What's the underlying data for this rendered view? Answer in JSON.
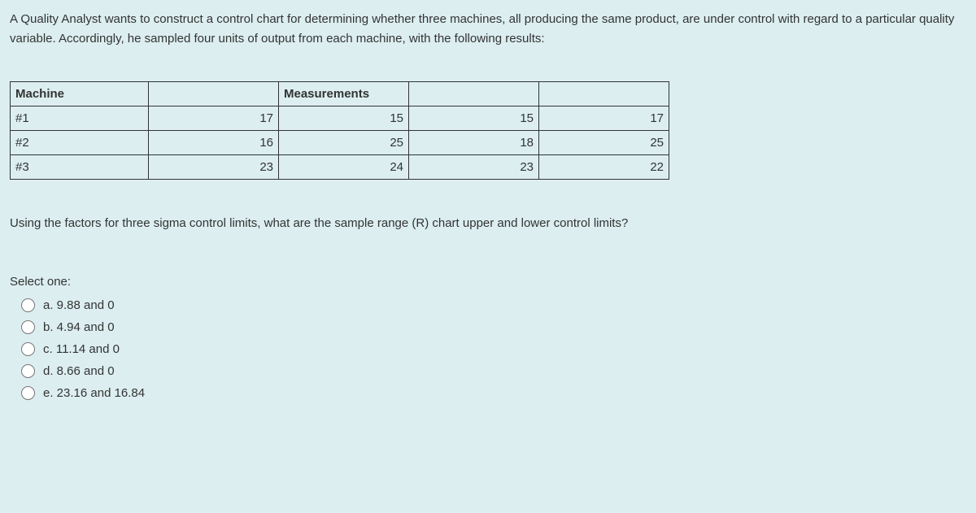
{
  "question": {
    "intro": "A Quality Analyst wants to construct a control chart for determining whether three machines, all producing the same product, are under control with regard to a particular quality variable. Accordingly, he sampled four units of output from each machine, with the following results:",
    "followup": "Using the factors for three sigma control limits, what are the sample range (R) chart upper and lower control limits?"
  },
  "table": {
    "header_machine": "Machine",
    "header_measurements": "Measurements",
    "rows": [
      {
        "machine": "#1",
        "m1": "17",
        "m2": "15",
        "m3": "15",
        "m4": "17"
      },
      {
        "machine": "#2",
        "m1": "16",
        "m2": "25",
        "m3": "18",
        "m4": "25"
      },
      {
        "machine": "#3",
        "m1": "23",
        "m2": "24",
        "m3": "23",
        "m4": "22"
      }
    ]
  },
  "select_one": "Select one:",
  "options": {
    "a": "a. 9.88 and 0",
    "b": "b. 4.94 and 0",
    "c": "c. 11.14 and 0",
    "d": "d. 8.66 and 0",
    "e": "e. 23.16 and 16.84"
  }
}
